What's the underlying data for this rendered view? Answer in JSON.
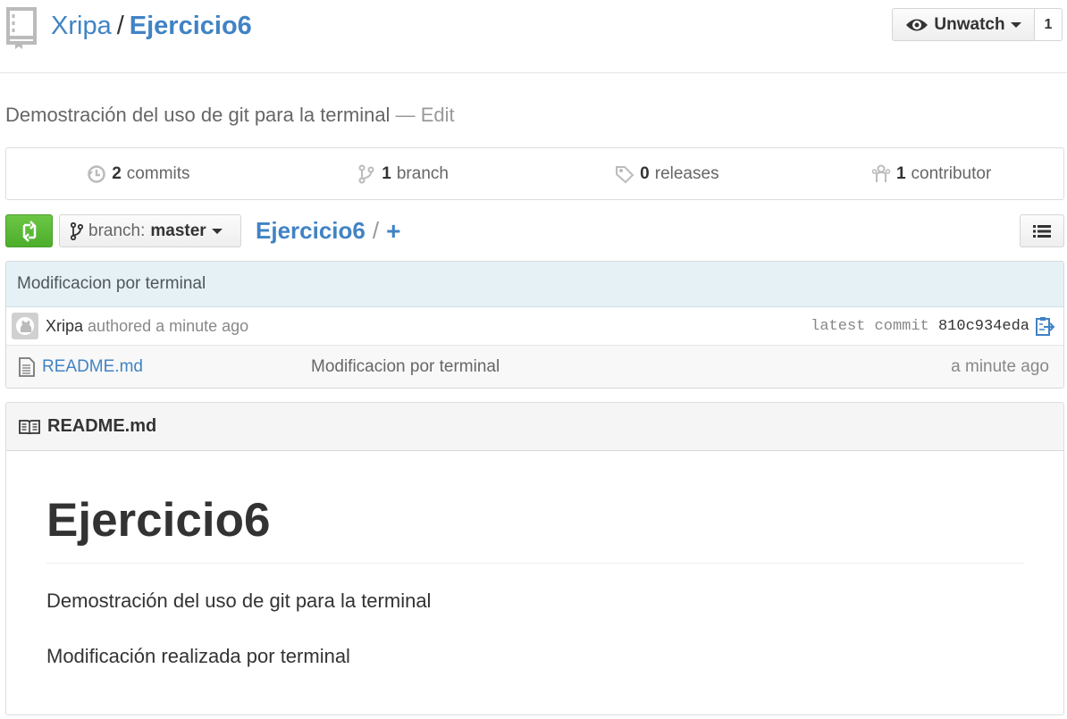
{
  "repo": {
    "owner": "Xripa",
    "separator": "/",
    "name": "Ejercicio6"
  },
  "watch": {
    "label": "Unwatch",
    "count": "1"
  },
  "description": {
    "text": "Demostración del uso de git para la terminal",
    "dash": "—",
    "edit_label": "Edit"
  },
  "stats": {
    "commits_count": "2",
    "commits_label": "commits",
    "branch_count": "1",
    "branch_label": "branch",
    "releases_count": "0",
    "releases_label": "releases",
    "contributor_count": "1",
    "contributor_label": "contributor"
  },
  "file_nav": {
    "branch_prefix": "branch:",
    "branch_name": "master",
    "crumb": "Ejercicio6",
    "slash": "/",
    "plus": "+"
  },
  "commit": {
    "message": "Modificacion por terminal",
    "author": "Xripa",
    "authored": "authored a minute ago",
    "latest_label": "latest commit",
    "sha": "810c934eda"
  },
  "files": [
    {
      "name": "README.md",
      "message": "Modificacion por terminal",
      "age": "a minute ago"
    }
  ],
  "readme": {
    "header": "README.md",
    "h1": "Ejercicio6",
    "p1": "Demostración del uso de git para la terminal",
    "p2": "Modificación realizada por terminal"
  },
  "colors": {
    "link": "#4183c4",
    "green": "#6cc644",
    "commit_bg": "#e6f1f6"
  }
}
